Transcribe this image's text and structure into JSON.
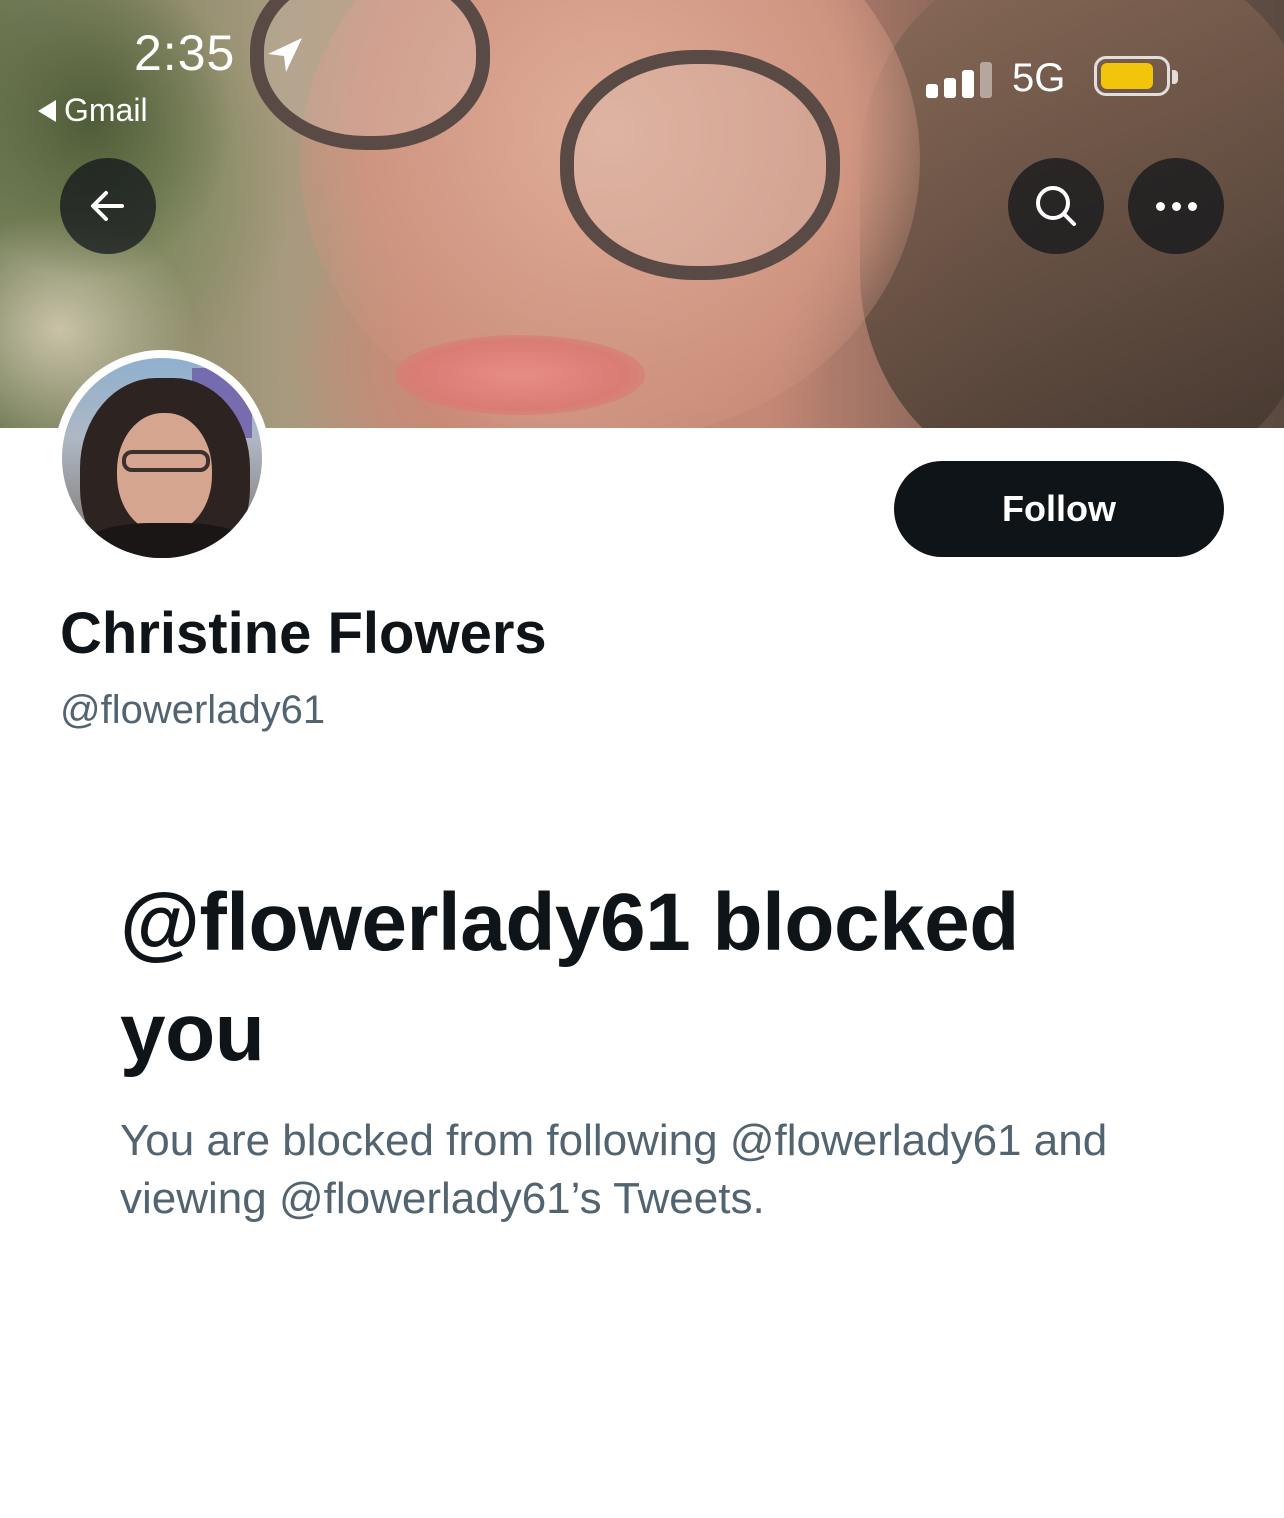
{
  "status_bar": {
    "time": "2:35",
    "back_app": "Gmail",
    "network": "5G",
    "battery_color": "#f2c40c"
  },
  "header": {
    "back_icon": "arrow-left-icon",
    "search_icon": "search-icon",
    "more_icon": "more-horizontal-icon"
  },
  "profile": {
    "display_name": "Christine Flowers",
    "handle": "@flowerlady61",
    "follow_label": "Follow"
  },
  "blocked": {
    "title": "@flowerlady61 blocked you",
    "description": "You are blocked from following @flowerlady61 and viewing @flowerlady61’s Tweets."
  },
  "colors": {
    "primary_text": "#0f1419",
    "secondary_text": "#536471",
    "button_bg": "#0f1419"
  }
}
